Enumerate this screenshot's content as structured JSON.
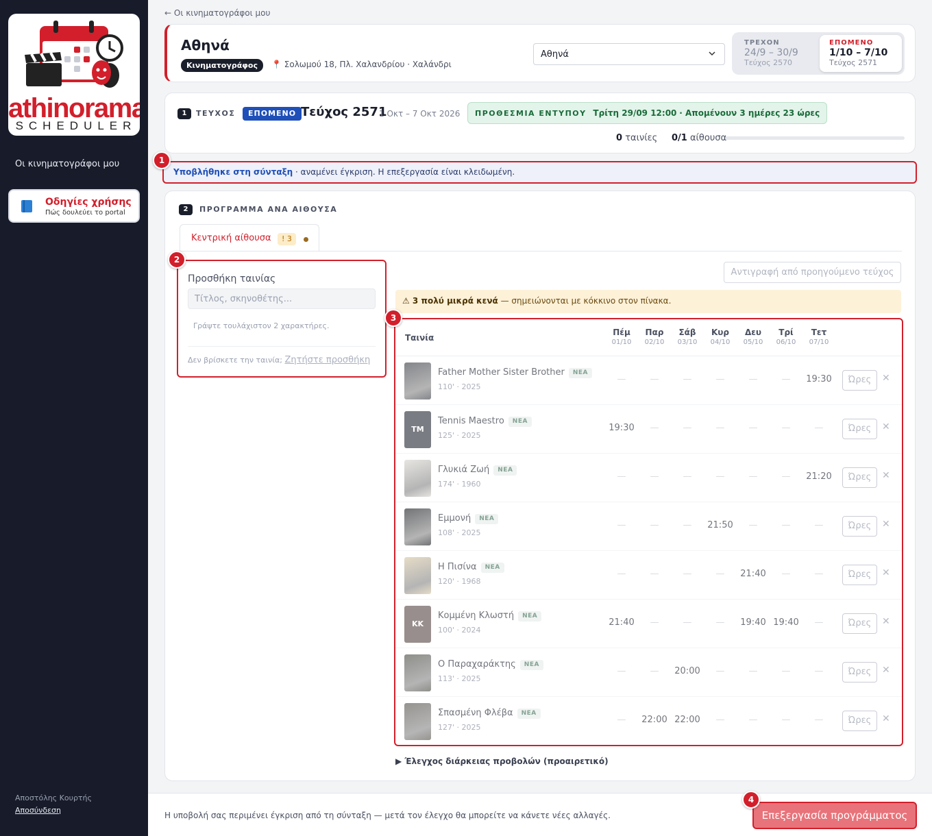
{
  "sidebar": {
    "logo_text": "athinorama",
    "logo_sub": "SCHEDULER",
    "nav_item": "Οι κινηματογράφοι μου",
    "help": {
      "title": "Οδηγίες χρήσης",
      "subtitle": "Πώς δουλεύει το portal",
      "icon": "book-icon"
    },
    "user": "Αποστόλης Κουρτής",
    "logout": "Αποσύνδεση"
  },
  "breadcrumb": "← Οι κινηματογράφοι μου",
  "header": {
    "title": "Αθηνά",
    "type_badge": "Κινηματογράφος",
    "address": "Σολωμού 18, Πλ. Χαλανδρίου · Χαλάνδρι",
    "cinema_select": "Αθηνά",
    "current_week": {
      "label": "ΤΡΕΧΟΝ",
      "range": "24/9 – 30/9",
      "issue": "Τεύχος 2570"
    },
    "next_week": {
      "label": "ΕΠΟΜΕΝΟ",
      "range": "1/10 – 7/10",
      "issue": "Τεύχος 2571"
    }
  },
  "issue": {
    "step": "1",
    "label": "ΤΕΥΧΟΣ",
    "badge": "ΕΠΟΜΕΝΟ",
    "title": "Τεύχος 2571",
    "dates": "1 Οκτ – 7 Οκτ 2026",
    "deadline_label": "ΠΡΟΘΕΣΜΙΑ ΕΝΤΥΠΟΥ",
    "deadline_date": "Τρίτη 29/09 12:00",
    "deadline_remaining": "· Απομένουν 3 ημέρες 23 ώρες",
    "films_count": "0",
    "films_label": "ταινίες",
    "halls_count": "0/1",
    "halls_label": "αίθουσα",
    "progress": 0
  },
  "submitted": {
    "strong": "Υποβλήθηκε στη σύνταξη",
    "text": " · αναμένει έγκριση. Η επεξεργασία είναι κλειδωμένη."
  },
  "program": {
    "step": "2",
    "label": "ΠΡΟΓΡΑΜΜΑ ΑΝΑ ΑΙΘΟΥΣΑ",
    "tab": {
      "name": "Κεντρική αίθουσα",
      "warn": "! 3"
    },
    "add_film": {
      "title": "Προσθήκη ταινίας",
      "placeholder": "Τίτλος, σκηνοθέτης...",
      "hint": "Γράψτε τουλάχιστον 2 χαρακτήρες.",
      "not_found": "Δεν βρίσκετε την ταινία;",
      "request_link": "Ζητήστε προσθήκη"
    },
    "copy_button": "Αντιγραφή από προηγούμενο τεύχος",
    "gaps_warning_strong": "⚠ 3 πολύ μικρά κενά",
    "gaps_warning_text": " — σημειώνονται με κόκκινο στον πίνακα.",
    "table": {
      "film_header": "Ταινία",
      "days": [
        {
          "name": "Πέμ",
          "date": "01/10"
        },
        {
          "name": "Παρ",
          "date": "02/10"
        },
        {
          "name": "Σάβ",
          "date": "03/10"
        },
        {
          "name": "Κυρ",
          "date": "04/10"
        },
        {
          "name": "Δευ",
          "date": "05/10"
        },
        {
          "name": "Τρί",
          "date": "06/10"
        },
        {
          "name": "Τετ",
          "date": "07/10"
        }
      ],
      "hours_label": "Ώρες",
      "new_badge": "ΝΕΑ",
      "rows": [
        {
          "title": "Father Mother Sister Brother",
          "meta": "110' · 2025",
          "poster": "image",
          "color": "#3a3d45",
          "times": [
            "—",
            "—",
            "—",
            "—",
            "—",
            "—",
            "19:30"
          ]
        },
        {
          "title": "Tennis Maestro",
          "meta": "125' · 2025",
          "poster": "TM",
          "color": "#2a2d38",
          "times": [
            "19:30",
            "—",
            "—",
            "—",
            "—",
            "—",
            "—"
          ]
        },
        {
          "title": "Γλυκιά Ζωή",
          "meta": "174' · 1960",
          "poster": "image",
          "color": "#d8d6d0",
          "times": [
            "—",
            "—",
            "—",
            "—",
            "—",
            "—",
            "21:20"
          ]
        },
        {
          "title": "Εμμονή",
          "meta": "108' · 2025",
          "poster": "image",
          "color": "#1c1f22",
          "times": [
            "—",
            "—",
            "—",
            "21:50",
            "—",
            "—",
            "—"
          ]
        },
        {
          "title": "Η Πισίνα",
          "meta": "120' · 1968",
          "poster": "image",
          "color": "#d7c7a6",
          "times": [
            "—",
            "—",
            "—",
            "—",
            "21:40",
            "—",
            "—"
          ]
        },
        {
          "title": "Κομμένη Κλωστή",
          "meta": "100' · 2024",
          "poster": "ΚΚ",
          "color": "#5a4a48",
          "times": [
            "21:40",
            "—",
            "—",
            "—",
            "19:40",
            "19:40",
            "—"
          ]
        },
        {
          "title": "Ο Παραχαράκτης",
          "meta": "113' · 2025",
          "poster": "image",
          "color": "#4a4a44",
          "times": [
            "—",
            "—",
            "20:00",
            "—",
            "—",
            "—",
            "—"
          ]
        },
        {
          "title": "Σπασμένη Φλέβα",
          "meta": "127' · 2025",
          "poster": "image",
          "color": "#55524c",
          "times": [
            "—",
            "22:00",
            "22:00",
            "—",
            "—",
            "—",
            "—"
          ]
        }
      ]
    },
    "duration_toggle": "▶  Έλεγχος διάρκειας προβολών (προαιρετικό)"
  },
  "footer": {
    "note": "Η υποβολή σας περιμένει έγκριση από τη σύνταξη — μετά τον έλεγχο θα μπορείτε να κάνετε νέες αλλαγές.",
    "edit_button": "Επεξεργασία προγράμματος"
  },
  "markers": [
    "1",
    "2",
    "3",
    "4"
  ],
  "colors": {
    "accent": "#d21f2b",
    "sidebar": "#171b2a",
    "issue_badge": "#1f4fb8",
    "deadline": "#1b6b3a"
  }
}
